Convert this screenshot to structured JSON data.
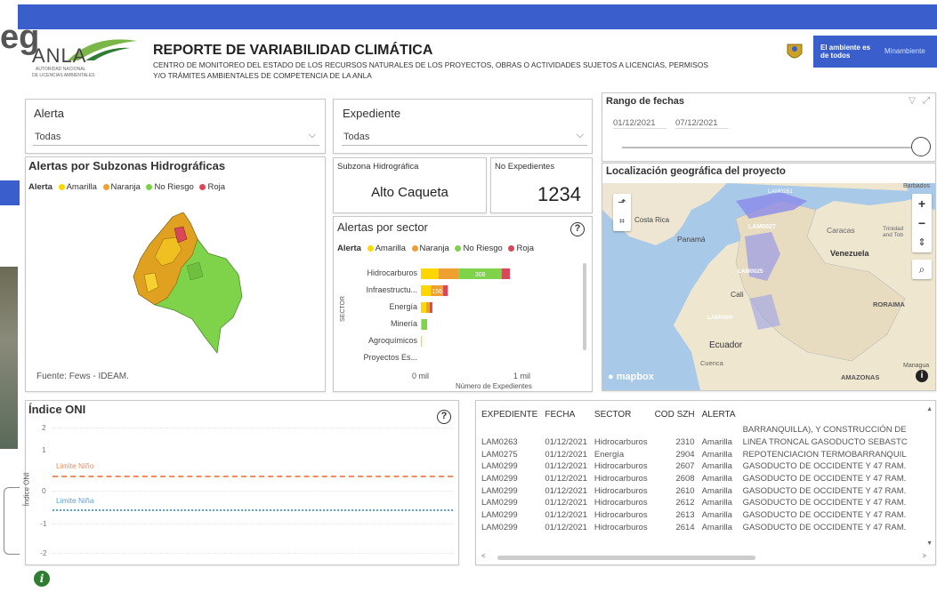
{
  "colors": {
    "brand_blue": "#3a5fcd",
    "amarilla": "#ffd700",
    "naranja": "#f0a030",
    "no_riesgo": "#7fd34a",
    "roja": "#d9485a",
    "limite_nino": "#f08c60",
    "limite_nina": "#5aa0e0"
  },
  "partial_left_text": "eg",
  "header": {
    "logo_text": "ANLA",
    "logo_sub1": "AUTORIDAD NACIONAL",
    "logo_sub2": "DE LICENCIAS AMBIENTALES",
    "title": "REPORTE DE VARIABILIDAD CLIMÁTICA",
    "subtitle1": "CENTRO DE MONITOREO DEL ESTADO DE LOS RECURSOS NATURALES DE LOS PROYECTOS, OBRAS O ACTIVIDADES SUJETOS A LICENCIAS, PERMISOS",
    "subtitle2": "Y/O TRÁMITES AMBIENTALES DE COMPETENCIA DE LA ANLA",
    "gov_text": "El ambiente es de todos",
    "ministry": "Minambiente"
  },
  "filters": {
    "alerta": {
      "label": "Alerta",
      "value": "Todas"
    },
    "expediente": {
      "label": "Expediente",
      "value": "Todas"
    },
    "rango": {
      "label": "Rango de fechas",
      "start": "01/12/2021",
      "end": "07/12/2021"
    }
  },
  "map_panel": {
    "title": "Alertas por Subzonas Hidrográficas",
    "legend_title": "Alerta",
    "legend": [
      "Amarilla",
      "Naranja",
      "No Riesgo",
      "Roja"
    ],
    "source": "Fuente: Fews - IDEAM."
  },
  "kpi": {
    "subzona_label": "Subzona Hidrográfica",
    "subzona_value": "Alto Caqueta",
    "expedientes_label": "No Expedientes",
    "expedientes_value": "1234"
  },
  "sector_chart": {
    "title": "Alertas por sector",
    "ylabel": "SECTOR",
    "xlabel": "Número de Expedientes",
    "xticks": [
      "0 mil",
      "1 mil"
    ],
    "legend_title": "Alerta",
    "help_icon": "?"
  },
  "chart_data": [
    {
      "type": "bar",
      "orientation": "horizontal",
      "stacked": true,
      "title": "Alertas por sector",
      "xlabel": "Número de Expedientes",
      "ylabel": "SECTOR",
      "categories": [
        "Hidrocarburos",
        "Infraestructu...",
        "Energía",
        "Minería",
        "Agroquímicos",
        "Proyectos Es..."
      ],
      "series": [
        {
          "name": "Amarilla",
          "values": [
            95,
            55,
            28,
            4,
            6,
            0
          ]
        },
        {
          "name": "Naranja",
          "values": [
            110,
            65,
            20,
            0,
            0,
            0
          ]
        },
        {
          "name": "No Riesgo",
          "values": [
            230,
            0,
            0,
            30,
            0,
            0
          ]
        },
        {
          "name": "Roja",
          "values": [
            45,
            25,
            14,
            0,
            0,
            0
          ]
        }
      ],
      "data_labels": [
        [
          "",
          "",
          "308",
          ""
        ],
        [
          "",
          "156",
          "",
          ""
        ]
      ],
      "xlim": [
        0,
        1600
      ]
    },
    {
      "type": "line",
      "title": "Índice ONI",
      "ylabel": "Índice ONI",
      "yticks": [
        "2",
        "1",
        "0",
        "-1",
        "-2"
      ],
      "ylim": [
        -2,
        2
      ],
      "reference_lines": [
        {
          "name": "Limite Niño",
          "y": 0.5
        },
        {
          "name": "Limite Niña",
          "y": -0.5
        }
      ]
    }
  ],
  "geo_map": {
    "title": "Localización geográfica del proyecto",
    "labels": [
      "Caracas",
      "Trinidad and Tob",
      "Venezuela",
      "Panamá",
      "Costa Rica",
      "Cali",
      "Ecuador",
      "Cuenca",
      "RORAIMA",
      "AMAZONAS",
      "Barbados",
      "Managua",
      "LAM0027",
      "LAM0261",
      "LAM0025",
      "LAM0060"
    ],
    "attribution": "mapbox"
  },
  "oni": {
    "title": "Índice ONI",
    "nino": "Limite Niño",
    "nina": "Limite Niña",
    "ylabel": "Índice ONI"
  },
  "table": {
    "headers": [
      "EXPEDIENTE",
      "FECHA",
      "SECTOR",
      "COD SZH",
      "ALERTA",
      ""
    ],
    "top_fragment": "BARRANQUILLA), Y CONSTRUCCIÓN DE",
    "rows": [
      [
        "LAM0263",
        "01/12/2021",
        "Hidrocarburos",
        "2310",
        "Amarilla",
        "LINEA TRONCAL GASODUCTO SEBASTC"
      ],
      [
        "LAM0275",
        "01/12/2021",
        "Energía",
        "2904",
        "Amarilla",
        "REPOTENCIACION TERMOBARRANQUIL"
      ],
      [
        "LAM0299",
        "01/12/2021",
        "Hidrocarburos",
        "2607",
        "Amarilla",
        "GASODUCTO DE OCCIDENTE Y 47 RAM."
      ],
      [
        "LAM0299",
        "01/12/2021",
        "Hidrocarburos",
        "2608",
        "Amarilla",
        "GASODUCTO DE OCCIDENTE Y 47 RAM."
      ],
      [
        "LAM0299",
        "01/12/2021",
        "Hidrocarburos",
        "2610",
        "Amarilla",
        "GASODUCTO DE OCCIDENTE Y 47 RAM."
      ],
      [
        "LAM0299",
        "01/12/2021",
        "Hidrocarburos",
        "2612",
        "Amarilla",
        "GASODUCTO DE OCCIDENTE Y 47 RAM."
      ],
      [
        "LAM0299",
        "01/12/2021",
        "Hidrocarburos",
        "2613",
        "Amarilla",
        "GASODUCTO DE OCCIDENTE Y 47 RAM."
      ],
      [
        "LAM0299",
        "01/12/2021",
        "Hidrocarburos",
        "2614",
        "Amarilla",
        "GASODUCTO DE OCCIDENTE Y 47 RAM."
      ]
    ]
  },
  "icons": {
    "info": "i",
    "filter": "filter-icon",
    "expand": "expand-icon"
  }
}
